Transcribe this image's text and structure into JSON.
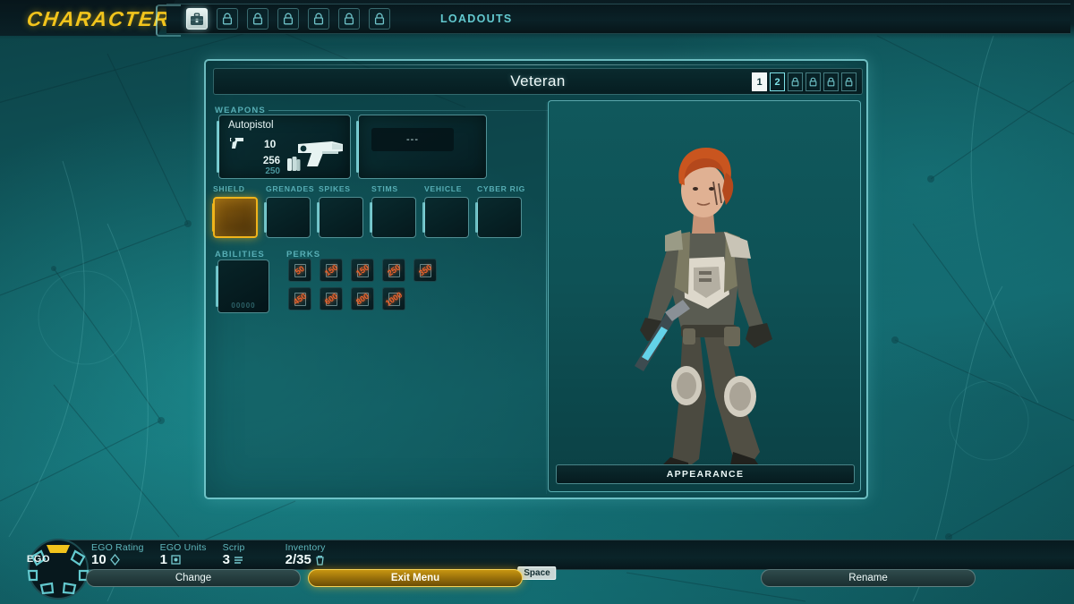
{
  "header": {
    "title": "CHARACTER",
    "loadouts_label": "LOADOUTS",
    "tabs": [
      {
        "name": "kit-tab",
        "icon": "briefcase-icon",
        "locked": false,
        "selected": true
      },
      {
        "name": "locked-tab-1",
        "icon": "lock-icon",
        "locked": true,
        "selected": false
      },
      {
        "name": "locked-tab-2",
        "icon": "lock-icon",
        "locked": true,
        "selected": false
      },
      {
        "name": "locked-tab-3",
        "icon": "lock-icon",
        "locked": true,
        "selected": false
      },
      {
        "name": "locked-tab-4",
        "icon": "lock-icon",
        "locked": true,
        "selected": false
      },
      {
        "name": "locked-tab-5",
        "icon": "lock-icon",
        "locked": true,
        "selected": false
      },
      {
        "name": "locked-tab-6",
        "icon": "lock-icon",
        "locked": true,
        "selected": false
      }
    ]
  },
  "panel": {
    "loadout_name": "Veteran",
    "loadout_slots": [
      {
        "label": "1",
        "state": "active"
      },
      {
        "label": "2",
        "state": "current"
      },
      {
        "label": "",
        "state": "locked"
      },
      {
        "label": "",
        "state": "locked"
      },
      {
        "label": "",
        "state": "locked"
      },
      {
        "label": "",
        "state": "locked"
      }
    ],
    "weapons": {
      "label": "WEAPONS",
      "primary": {
        "name": "Autopistol",
        "damage": "10",
        "ammo_current": "256",
        "ammo_reserve": "250"
      },
      "secondary": {
        "empty_text": "---"
      }
    },
    "equipment": [
      {
        "label": "SHIELD",
        "selected": true
      },
      {
        "label": "GRENADES",
        "selected": false
      },
      {
        "label": "SPIKES",
        "selected": false
      },
      {
        "label": "STIMS",
        "selected": false
      },
      {
        "label": "VEHICLE",
        "selected": false
      },
      {
        "label": "CYBER RIG",
        "selected": false
      }
    ],
    "abilities": {
      "label": "ABILITIES",
      "slot_cost": "00000"
    },
    "perks": {
      "label": "PERKS",
      "row1": [
        "50",
        "150",
        "150",
        "250",
        "350"
      ],
      "row2": [
        "450",
        "600",
        "800",
        "1000"
      ]
    },
    "appearance_label": "APPEARANCE"
  },
  "status": {
    "ego_label": "EGO",
    "ego_key": "Space",
    "stats": [
      {
        "name": "EGO Rating",
        "value": "10",
        "icon": "ego-rating-icon"
      },
      {
        "name": "EGO Units",
        "value": "1",
        "icon": "ego-units-icon"
      },
      {
        "name": "Scrip",
        "value": "3",
        "icon": "scrip-icon"
      },
      {
        "name": "Inventory",
        "value": "2/35",
        "icon": "inventory-icon"
      }
    ]
  },
  "footer": {
    "change_label": "Change",
    "exit_label": "Exit Menu",
    "rename_label": "Rename"
  },
  "colors": {
    "accent_yellow": "#f2c41c",
    "accent_cyan": "#7ee2e8",
    "perk_orange": "#f0632a",
    "bg_teal": "#10575c"
  }
}
